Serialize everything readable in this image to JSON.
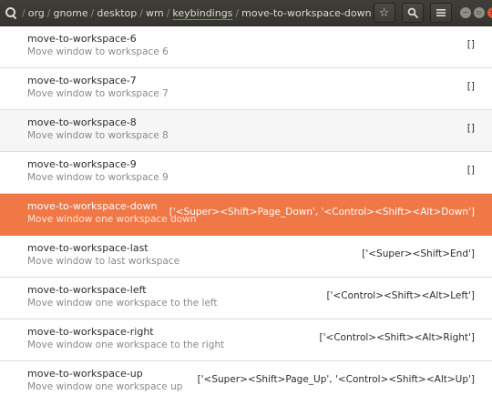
{
  "pathbar": {
    "separator": "/",
    "crumbs": [
      "org",
      "gnome",
      "desktop",
      "wm",
      "keybindings",
      "move-to-workspace-down"
    ],
    "active_index": 4
  },
  "toolbar": {
    "bookmark_glyph": "☆",
    "search_icon": "search-icon",
    "menu_icon": "hamburger-menu-icon",
    "window_controls": {
      "minimize": "−",
      "maximize": "▫",
      "close": "×"
    }
  },
  "colors": {
    "header_bg": "#3a3935",
    "accent": "#e4572e",
    "selected_row": "#f07746",
    "text": "#2c2c2c",
    "secondary_text": "#8a8a8a"
  },
  "rows": [
    {
      "name": "move-to-workspace-6",
      "description": "Move window to workspace 6",
      "value": "[]"
    },
    {
      "name": "move-to-workspace-7",
      "description": "Move window to workspace 7",
      "value": "[]"
    },
    {
      "name": "move-to-workspace-8",
      "description": "Move window to workspace 8",
      "value": "[]"
    },
    {
      "name": "move-to-workspace-9",
      "description": "Move window to workspace 9",
      "value": "[]"
    },
    {
      "name": "move-to-workspace-down",
      "description": "Move window one workspace down",
      "value": "['<Super><Shift>Page_Down', '<Control><Shift><Alt>Down']"
    },
    {
      "name": "move-to-workspace-last",
      "description": "Move window to last workspace",
      "value": "['<Super><Shift>End']"
    },
    {
      "name": "move-to-workspace-left",
      "description": "Move window one workspace to the left",
      "value": "['<Control><Shift><Alt>Left']"
    },
    {
      "name": "move-to-workspace-right",
      "description": "Move window one workspace to the right",
      "value": "['<Control><Shift><Alt>Right']"
    },
    {
      "name": "move-to-workspace-up",
      "description": "Move window one workspace up",
      "value": "['<Super><Shift>Page_Up', '<Control><Shift><Alt>Up']"
    }
  ],
  "selected_index": 4
}
